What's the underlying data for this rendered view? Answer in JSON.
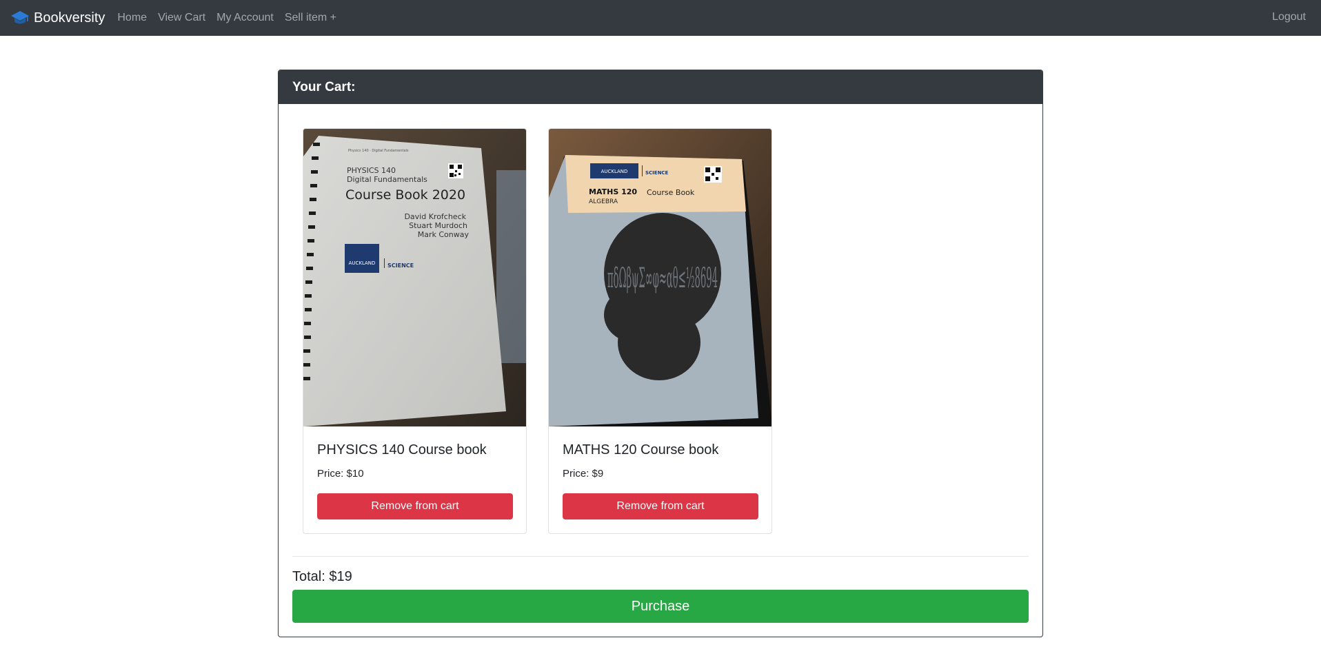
{
  "navbar": {
    "brand": "Bookversity",
    "brand_icon": "graduation-cap-icon",
    "links": [
      "Home",
      "View Cart",
      "My Account",
      "Sell item +"
    ],
    "logout": "Logout"
  },
  "cart": {
    "title": "Your Cart:",
    "items": [
      {
        "title": "PHYSICS 140 Course book",
        "price_label": "Price: $10",
        "remove_label": "Remove from cart",
        "cover": {
          "small_text": "Physics 140 · Digital Fundamentals",
          "course": "PHYSICS 140",
          "subtitle": "Digital Fundamentals",
          "heading": "Course Book 2020",
          "authors": [
            "David Krofcheck",
            "Stuart Murdoch",
            "Mark Conway"
          ],
          "university": "AUCKLAND",
          "faculty": "SCIENCE"
        }
      },
      {
        "title": "MATHS 120 Course book",
        "price_label": "Price: $9",
        "remove_label": "Remove from cart",
        "cover": {
          "university": "AUCKLAND",
          "faculty": "SCIENCE",
          "course": "MATHS 120",
          "heading": "Course Book",
          "subtitle": "ALGEBRA",
          "glyphs": "πδΩβψΣ∞φ≈αθ≤½8694"
        }
      }
    ],
    "total_label": "Total: $19",
    "purchase_label": "Purchase"
  },
  "colors": {
    "navbar": "#343a40",
    "danger": "#dc3545",
    "success": "#28a745"
  }
}
